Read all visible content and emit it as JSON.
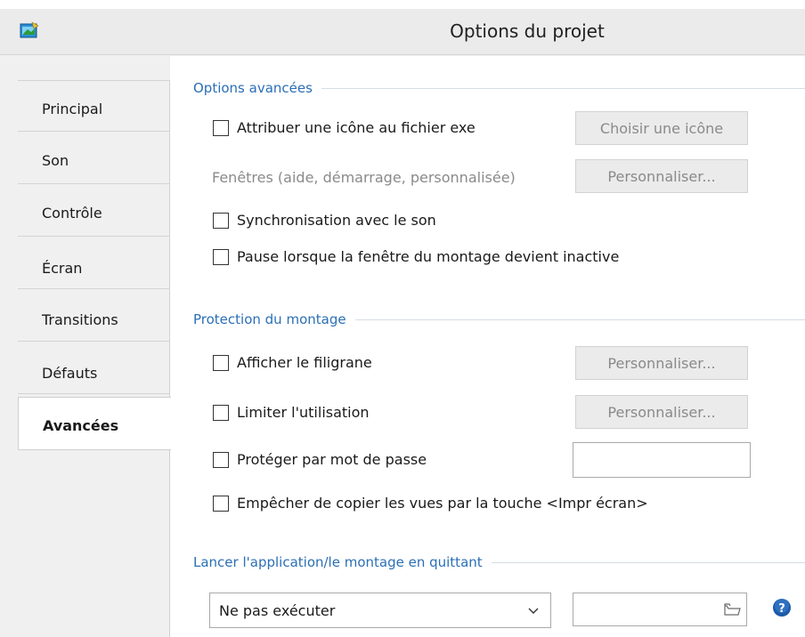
{
  "window": {
    "title": "Options du projet"
  },
  "sidebar": {
    "tabs": [
      {
        "label": "Principal"
      },
      {
        "label": "Son"
      },
      {
        "label": "Contrôle"
      },
      {
        "label": "Écran"
      },
      {
        "label": "Transitions"
      },
      {
        "label": "Défauts"
      },
      {
        "label": "Avancées",
        "active": true
      }
    ]
  },
  "sections": {
    "advanced": {
      "title": "Options avancées",
      "assign_icon": {
        "label": "Attribuer une icône au fichier exe",
        "checked": false,
        "button": "Choisir une icône"
      },
      "windows": {
        "label": "Fenêtres (aide, démarrage, personnalisée)",
        "button": "Personnaliser..."
      },
      "sync_sound": {
        "label": "Synchronisation avec le son",
        "checked": false
      },
      "pause_inactive": {
        "label": "Pause lorsque la fenêtre du montage devient inactive",
        "checked": false
      }
    },
    "protection": {
      "title": "Protection du montage",
      "watermark": {
        "label": "Afficher le filigrane",
        "checked": false,
        "button": "Personnaliser..."
      },
      "limit_use": {
        "label": "Limiter l'utilisation",
        "checked": false,
        "button": "Personnaliser..."
      },
      "password": {
        "label": "Protéger par mot de passe",
        "checked": false,
        "value": ""
      },
      "prevent_copy": {
        "label": "Empêcher de copier les vues par la touche <Impr écran>",
        "checked": false
      }
    },
    "launch": {
      "title": "Lancer l'application/le montage en quittant",
      "select_value": "Ne pas exécuter",
      "path_value": ""
    }
  },
  "colors": {
    "section_title": "#2b6fb5",
    "disabled_text": "#8a8a8a",
    "help_icon": "#1d5aa8"
  },
  "icons": [
    "app-icon",
    "chevron-down-icon",
    "folder-open-icon",
    "help-icon"
  ]
}
